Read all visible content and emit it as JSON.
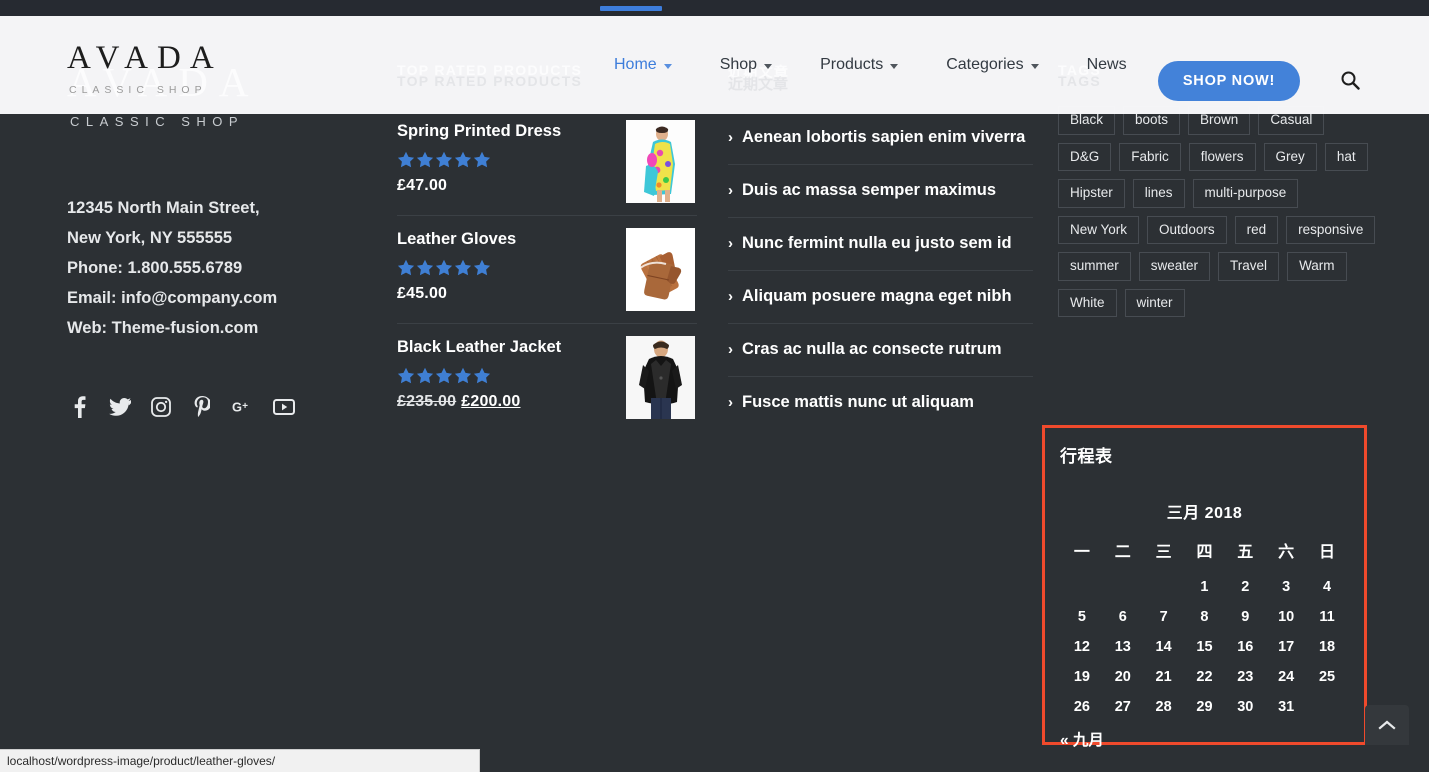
{
  "browser": {
    "status_url": "localhost/wordpress-image/product/leather-gloves/"
  },
  "header": {
    "logo_word": "AVADA",
    "logo_sub": "CLASSIC SHOP",
    "nav": [
      {
        "label": "Home",
        "has_caret": true,
        "active": true
      },
      {
        "label": "Shop",
        "has_caret": true,
        "active": false
      },
      {
        "label": "Products",
        "has_caret": true,
        "active": false
      },
      {
        "label": "Categories",
        "has_caret": true,
        "active": false
      },
      {
        "label": "News",
        "has_caret": false,
        "active": false
      }
    ],
    "cta_label": "SHOP NOW!",
    "accent_color": "#4382d9"
  },
  "footer": {
    "logo_word": "AVADA",
    "logo_sub": "CLASSIC SHOP",
    "address": [
      "12345 North Main Street,",
      "New York, NY 555555",
      "Phone: 1.800.555.6789",
      "Email: info@company.com",
      "Web: Theme-fusion.com"
    ],
    "social": [
      {
        "name": "facebook-icon"
      },
      {
        "name": "twitter-icon"
      },
      {
        "name": "instagram-icon"
      },
      {
        "name": "pinterest-icon"
      },
      {
        "name": "googleplus-icon"
      },
      {
        "name": "youtube-icon"
      }
    ]
  },
  "widgets": {
    "products": {
      "title": "TOP RATED PRODUCTS",
      "items": [
        {
          "name": "Spring Printed Dress",
          "rating": 5,
          "price": "£47.00",
          "old_price": "",
          "sale_price": "",
          "on_sale": false,
          "thumb": "dress"
        },
        {
          "name": "Leather Gloves",
          "rating": 5,
          "price": "£45.00",
          "old_price": "",
          "sale_price": "",
          "on_sale": false,
          "thumb": "gloves"
        },
        {
          "name": "Black Leather Jacket",
          "rating": 5,
          "price": "",
          "old_price": "£235.00",
          "sale_price": "£200.00",
          "on_sale": true,
          "thumb": "jacket"
        }
      ]
    },
    "posts": {
      "title": "近期文章",
      "items": [
        "Aenean lobortis sapien enim viverra",
        "Duis ac massa semper maximus",
        "Nunc fermint nulla eu justo sem id",
        "Aliquam posuere magna eget nibh",
        "Cras ac nulla ac consecte rutrum",
        "Fusce mattis nunc ut aliquam"
      ]
    },
    "tags": {
      "title": "TAGS",
      "items": [
        "Black",
        "boots",
        "Brown",
        "Casual",
        "D&G",
        "Fabric",
        "flowers",
        "Grey",
        "hat",
        "Hipster",
        "lines",
        "multi-purpose",
        "New York",
        "Outdoors",
        "red",
        "responsive",
        "summer",
        "sweater",
        "Travel",
        "Warm",
        "White",
        "winter"
      ]
    },
    "calendar": {
      "title": "行程表",
      "caption": "三月 2018",
      "weekdays": [
        "一",
        "二",
        "三",
        "四",
        "五",
        "六",
        "日"
      ],
      "weeks": [
        [
          "",
          "",
          "",
          "1",
          "2",
          "3",
          "4"
        ],
        [
          "5",
          "6",
          "7",
          "8",
          "9",
          "10",
          "11"
        ],
        [
          "12",
          "13",
          "14",
          "15",
          "16",
          "17",
          "18"
        ],
        [
          "19",
          "20",
          "21",
          "22",
          "23",
          "24",
          "25"
        ],
        [
          "26",
          "27",
          "28",
          "29",
          "30",
          "31",
          ""
        ]
      ],
      "prev_label": "« 九月",
      "highlight_color": "#f04a2c"
    }
  },
  "controls": {
    "scroll_top_label": "scroll-to-top"
  },
  "colors": {
    "footer_bg": "#2c3034",
    "star": "#3f7fd4",
    "header_bg": "#fcfcfd"
  }
}
